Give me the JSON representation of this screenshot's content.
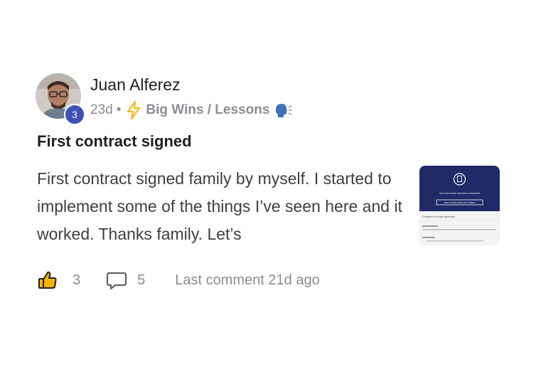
{
  "post": {
    "author": "Juan Alferez",
    "level": "3",
    "time_ago": "23d",
    "separator": "•",
    "category": "Big Wins / Lessons",
    "title": "First contract signed",
    "body": "First contract signed family by myself. I started to implement some of the things I’ve seen here and it worked. Thanks family. Let’s",
    "attachment": {
      "heading": "Your document has been completed",
      "button": "VIEW COMPLETED DOCUMENT",
      "caption": "Completed Purchase Agreement"
    }
  },
  "footer": {
    "likes": "3",
    "comments": "5",
    "last_comment": "Last comment 21d ago"
  },
  "icons": {
    "category_icon": "lightning-bolt-icon",
    "category_emoji": "speaking-head-icon",
    "like": "thumbs-up-icon",
    "comment": "comment-bubble-icon"
  },
  "colors": {
    "badge": "#3f51b5",
    "bolt": "#f5b400",
    "muted_text": "#8a8d91",
    "thumb_header": "#1f2a66"
  }
}
